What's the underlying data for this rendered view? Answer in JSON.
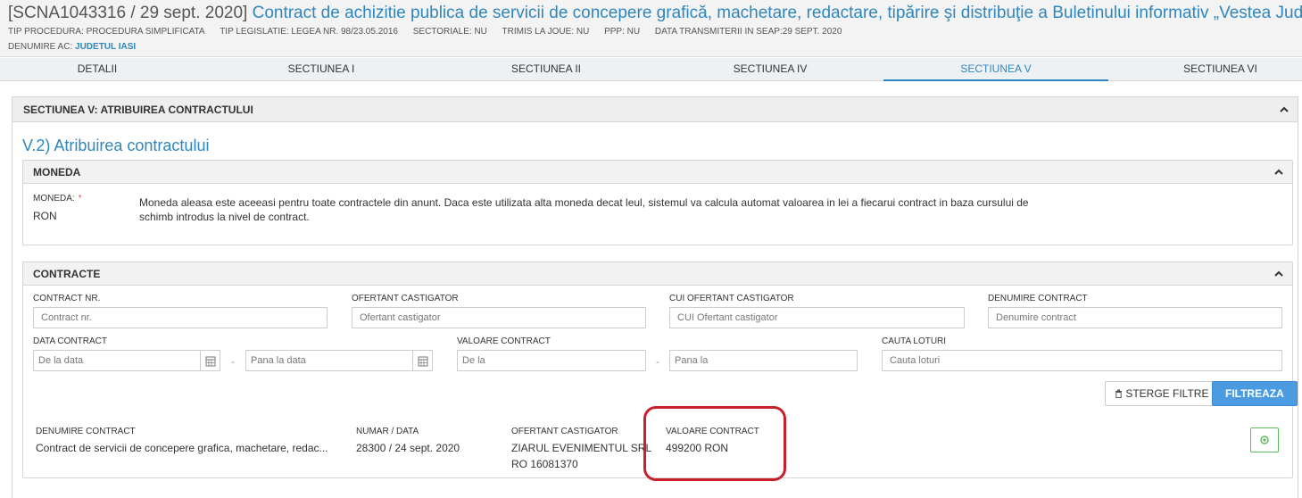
{
  "header": {
    "id": "[SCNA1043316 / 29 sept. 2020]",
    "title": "Contract de achizitie publica de servicii de concepere grafică, machetare, redactare, tipărire şi distribuţie a Buletinului informativ „Vestea Judeţului”",
    "meta": {
      "tip_procedura": "TIP PROCEDURA: PROCEDURA SIMPLIFICATA",
      "tip_legislatie": "TIP LEGISLATIE: LEGEA NR. 98/23.05.2016",
      "sectoriale": "SECTORIALE: NU",
      "trimis_joue": "TRIMIS LA JOUE: NU",
      "ppp": "PPP: NU",
      "data_transmiterii": "DATA TRANSMITERII IN SEAP:29 SEPT. 2020"
    },
    "denumire_ac_label": "DENUMIRE AC:",
    "denumire_ac_value": "JUDETUL IASI"
  },
  "tabs": [
    {
      "label": "DETALII"
    },
    {
      "label": "SECTIUNEA I"
    },
    {
      "label": "SECTIUNEA II"
    },
    {
      "label": "SECTIUNEA IV"
    },
    {
      "label": "SECTIUNEA V"
    },
    {
      "label": "SECTIUNEA VI"
    }
  ],
  "active_tab": "SECTIUNEA V",
  "section": {
    "title": "SECTIUNEA V: ATRIBUIREA CONTRACTULUI",
    "subtitle": "V.2) Atribuirea contractului"
  },
  "moneda": {
    "title": "MONEDA",
    "label": "MONEDA:",
    "required": "*",
    "value": "RON",
    "note": "Moneda aleasa este aceeasi pentru toate contractele din anunt. Daca este utilizata alta moneda decat leul, sistemul va calcula automat valoarea in lei a fiecarui contract in baza cursului de schimb introdus la nivel de contract."
  },
  "contracte": {
    "title": "CONTRACTE",
    "filters": {
      "contract_nr": {
        "label": "CONTRACT NR.",
        "placeholder": "Contract nr."
      },
      "ofertant": {
        "label": "OFERTANT CASTIGATOR",
        "placeholder": "Ofertant castigator"
      },
      "cui": {
        "label": "CUI OFERTANT CASTIGATOR",
        "placeholder": "CUI Ofertant castigator"
      },
      "denumire": {
        "label": "DENUMIRE CONTRACT",
        "placeholder": "Denumire contract"
      },
      "data_contract": {
        "label": "DATA CONTRACT",
        "from": "De la data",
        "to": "Pana la data"
      },
      "valoare_contract": {
        "label": "VALOARE CONTRACT",
        "from": "De la",
        "to": "Pana la"
      },
      "cauta_loturi": {
        "label": "CAUTA LOTURI",
        "placeholder": "Cauta loturi"
      }
    },
    "dash": "-",
    "btn_clear": "STERGE FILTRE",
    "btn_filter": "FILTREAZA",
    "columns": {
      "denumire": "DENUMIRE CONTRACT",
      "numar": "NUMAR / DATA",
      "ofertant": "OFERTANT CASTIGATOR",
      "valoare": "VALOARE CONTRACT"
    },
    "rows": [
      {
        "denumire": "Contract de servicii de concepere grafica, machetare, redac...",
        "numar": "28300 / 24 sept. 2020",
        "ofertant_name": "ZIARUL EVENIMENTUL SRL",
        "ofertant_cui": "RO 16081370",
        "valoare": "499200 RON"
      }
    ]
  },
  "colors": {
    "accent": "#2f87c0",
    "filter_button": "#4b9be0",
    "highlight": "#c8202a",
    "view_button": "#5cb85c"
  }
}
